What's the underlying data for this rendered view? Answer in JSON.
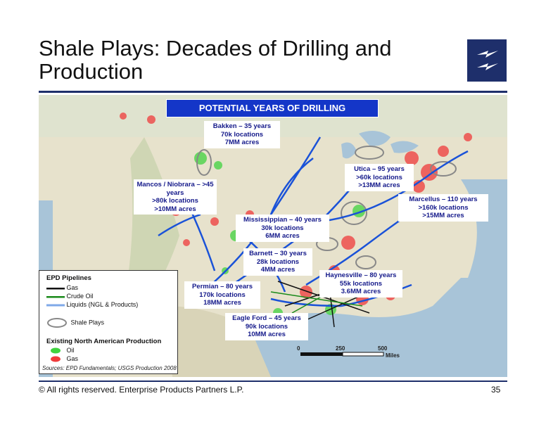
{
  "slide": {
    "title": "Shale Plays:  Decades of Drilling and Production",
    "footer": "©  All rights reserved. Enterprise Products Partners L.P.",
    "page_number": "35"
  },
  "map": {
    "banner": "POTENTIAL YEARS OF DRILLING",
    "plays": [
      {
        "name": "Bakken – 35 years",
        "locations": "70k locations",
        "acres": "7MM acres"
      },
      {
        "name": "Mancos / Niobrara – >45 years",
        "locations": ">80k locations",
        "acres": ">10MM acres"
      },
      {
        "name": "Utica – 95 years",
        "locations": ">60k locations",
        "acres": ">13MM acres"
      },
      {
        "name": "Marcellus – 110 years",
        "locations": ">160k locations",
        "acres": ">15MM acres"
      },
      {
        "name": "Mississippian – 40 years",
        "locations": "30k locations",
        "acres": "6MM acres"
      },
      {
        "name": "Barnett – 30 years",
        "locations": "28k locations",
        "acres": "4MM acres"
      },
      {
        "name": "Haynesville – 80 years",
        "locations": "55k locations",
        "acres": "3.6MM acres"
      },
      {
        "name": "Permian – 80 years",
        "locations": "170k locations",
        "acres": "18MM acres"
      },
      {
        "name": "Eagle Ford – 45 years",
        "locations": "90k locations",
        "acres": "10MM acres"
      }
    ],
    "scale": {
      "ticks": [
        "0",
        "250",
        "500"
      ],
      "unit": "Miles"
    },
    "colors": {
      "land": "#e7e2cc",
      "water": "#a8c4d8",
      "pipeline_liquids": "#1a52d8",
      "oil": "#3fd33f",
      "gas": "#ef3b3b"
    }
  },
  "legend": {
    "pipelines_title": "EPD Pipelines",
    "gas": "Gas",
    "crude": "Crude Oil",
    "liquids": "Liquids (NGL & Products)",
    "shale": "Shale Plays",
    "production_title": "Existing North American Production",
    "oil": "Oil",
    "gas_prod": "Gas",
    "sources": "Sources:  EPD Fundamentals; USGS Production 2008"
  }
}
